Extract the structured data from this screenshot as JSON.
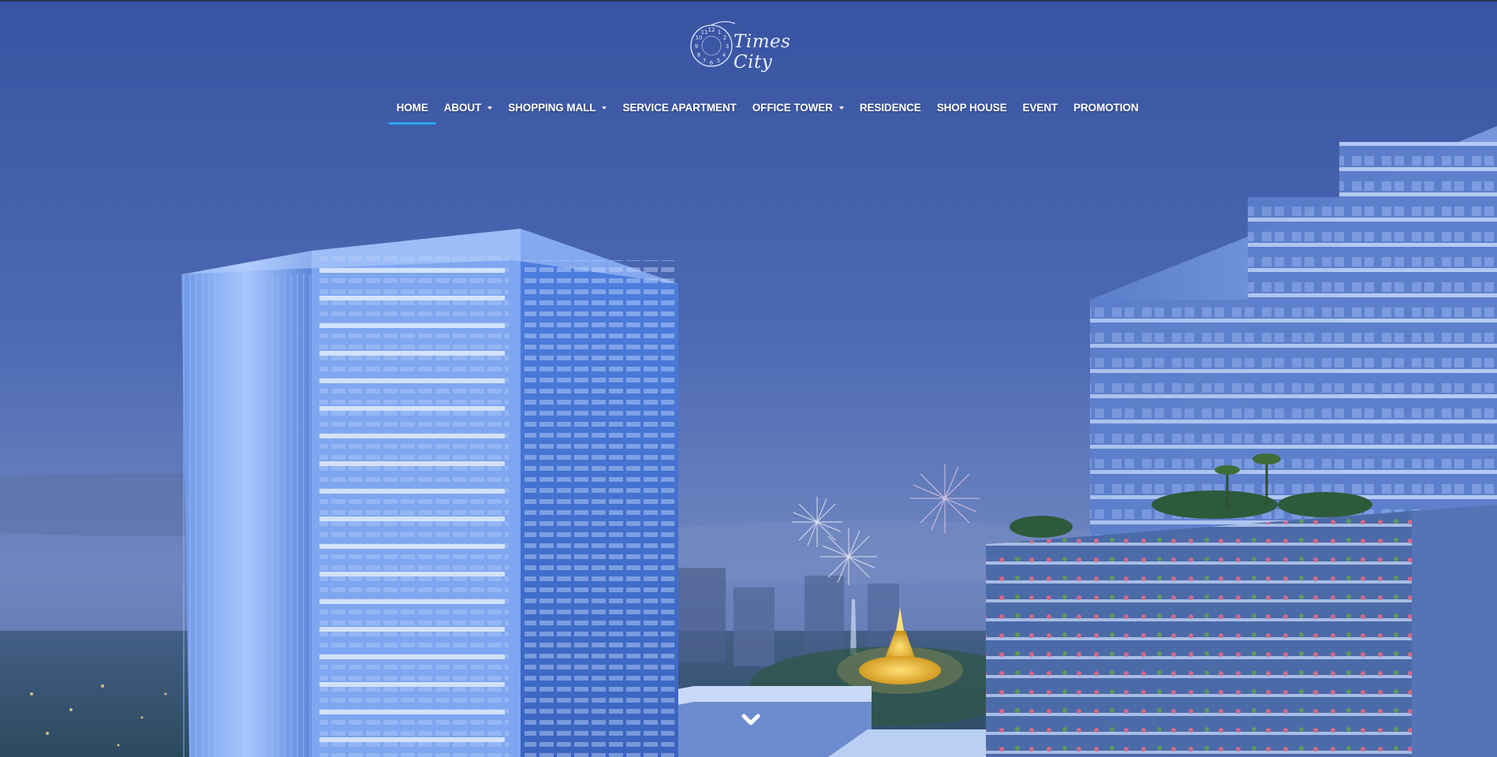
{
  "brand": {
    "logo_text": "Times City",
    "logo_icon": "clock-icon"
  },
  "nav": {
    "items": [
      {
        "label": "HOME",
        "active": true,
        "dropdown": false
      },
      {
        "label": "ABOUT",
        "active": false,
        "dropdown": true
      },
      {
        "label": "SHOPPING MALL",
        "active": false,
        "dropdown": true
      },
      {
        "label": "SERVICE APARTMENT",
        "active": false,
        "dropdown": false
      },
      {
        "label": "OFFICE TOWER",
        "active": false,
        "dropdown": true
      },
      {
        "label": "RESIDENCE",
        "active": false,
        "dropdown": false
      },
      {
        "label": "SHOP HOUSE",
        "active": false,
        "dropdown": false
      },
      {
        "label": "EVENT",
        "active": false,
        "dropdown": false
      },
      {
        "label": "PROMOTION",
        "active": false,
        "dropdown": false
      }
    ],
    "active_indicator_color": "#2ea3f2"
  },
  "hero": {
    "scene": "city-skyline-night",
    "scroll_icon": "chevron-down-icon"
  },
  "colors": {
    "sky_top": "#3a56a3",
    "sky_horizon": "#6d86c2",
    "accent": "#2ea3f2",
    "text": "#ffffff"
  }
}
